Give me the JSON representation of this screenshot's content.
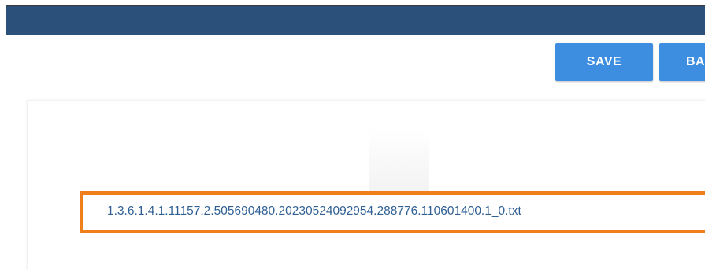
{
  "toolbar": {
    "save_label": "SAVE",
    "back_label": "BA"
  },
  "attachment": {
    "filename": "1.3.6.1.4.1.11157.2.505690480.20230524092954.288776.110601400.1_0.txt"
  },
  "colors": {
    "header": "#2b5079",
    "button": "#3d8ee0",
    "highlight_border": "#f07f1b",
    "filename_text": "#2f5f93"
  }
}
